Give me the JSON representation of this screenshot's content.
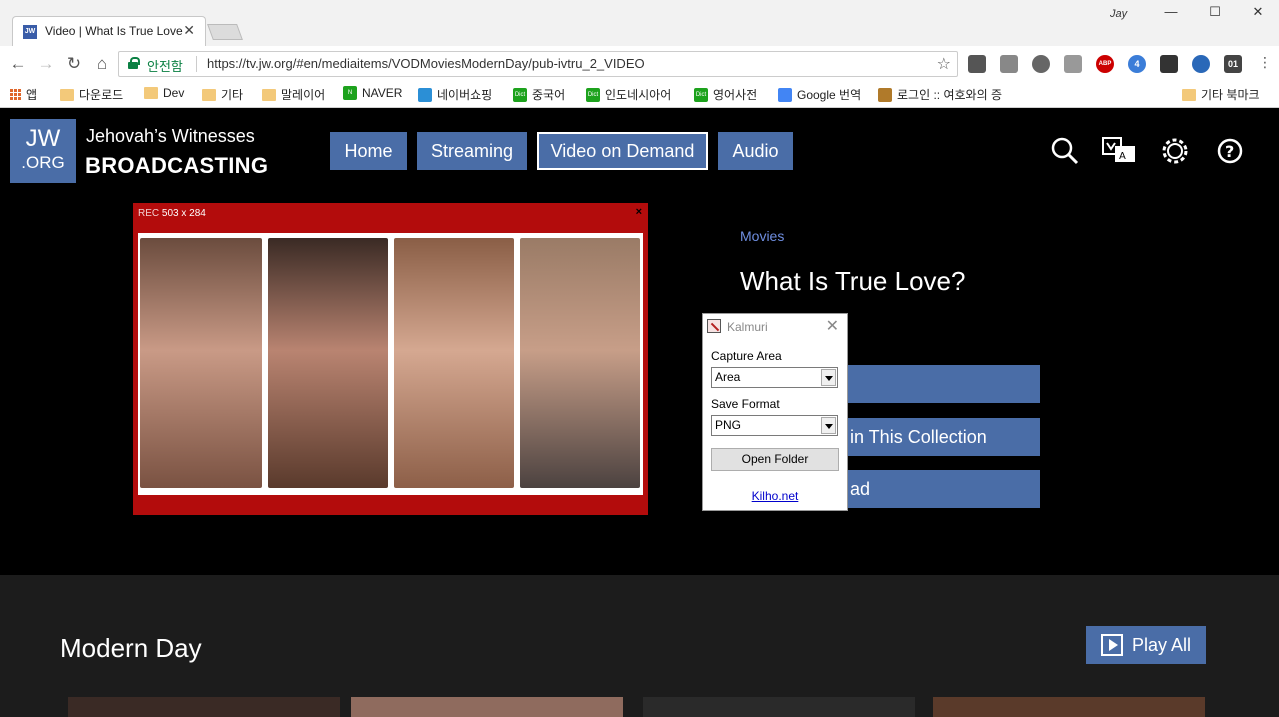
{
  "browser": {
    "tab_title": "Video | What Is True Love?",
    "tab_favicon": "JW",
    "user_label": "Jay",
    "secure_label": "안전함",
    "url": "https://tv.jw.org/#en/mediaitems/VODMoviesModernDay/pub-ivtru_2_VIDEO",
    "extensions": [
      "abp-icon",
      "profile-icon"
    ],
    "ext_badge_1": "4",
    "ext_label_01": "01"
  },
  "bookmarks": {
    "items": [
      "앱",
      "다운로드",
      "Dev",
      "기타",
      "말레이어",
      "NAVER",
      "네이버쇼핑",
      "중국어",
      "인도네시아어",
      "영어사전",
      "Google 번역",
      "로그인 :: 여호와의 증"
    ],
    "other": "기타 북마크",
    "dict_label": "Dict",
    "abp_label": "ABP"
  },
  "site": {
    "logo_line1": "JW",
    "logo_line2": ".ORG",
    "brand_line1": "Jehovah’s Witnesses",
    "brand_line2": "BROADCASTING",
    "nav": [
      "Home",
      "Streaming",
      "Video on Demand",
      "Audio"
    ],
    "accent": "#4a6da7"
  },
  "player": {
    "rec_label": "REC",
    "rec_size": "503 x 284",
    "close": "×"
  },
  "video": {
    "category": "Movies",
    "title": "What Is True Love?",
    "buttons": [
      "Play",
      "Other Videos in This Collection",
      "Download"
    ],
    "visible_button_text": [
      "",
      "in This Collection",
      "ad"
    ]
  },
  "section": {
    "title": "Modern Day",
    "play_all": "Play All"
  },
  "dialog": {
    "title": "Kalmuri",
    "capture_label": "Capture Area",
    "capture_value": "Area",
    "format_label": "Save Format",
    "format_value": "PNG",
    "open_folder": "Open Folder",
    "link": "Kilho.net"
  }
}
